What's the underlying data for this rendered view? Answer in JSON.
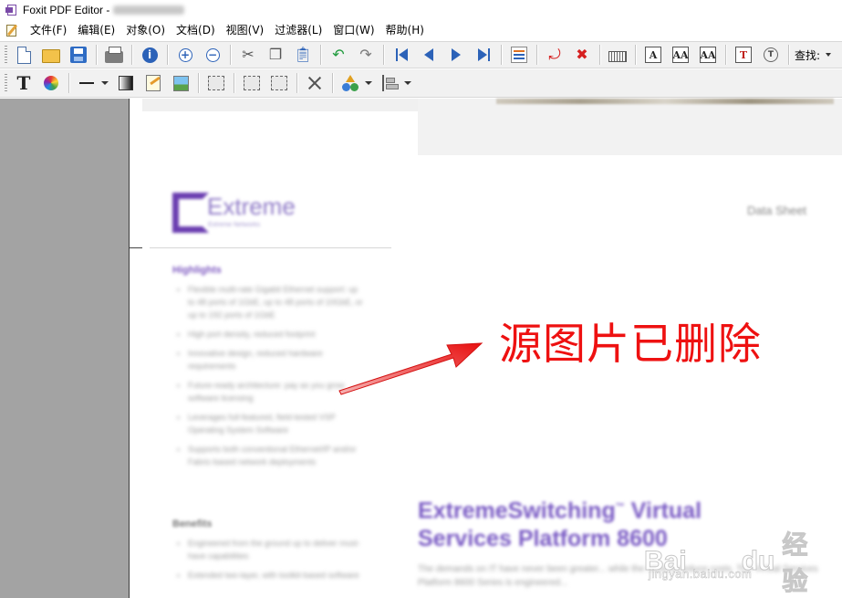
{
  "window": {
    "title": "Foxit PDF Editor -",
    "colors": {
      "toolbar_bg": "#f1f1f1",
      "left_pane": "#a3a3a3",
      "annotation_red": "#ee1111",
      "brand_purple": "#7a5bc4"
    }
  },
  "menu": {
    "items": [
      {
        "label": "文件(F)"
      },
      {
        "label": "编辑(E)"
      },
      {
        "label": "对象(O)"
      },
      {
        "label": "文档(D)"
      },
      {
        "label": "视图(V)"
      },
      {
        "label": "过滤器(L)"
      },
      {
        "label": "窗口(W)"
      },
      {
        "label": "帮助(H)"
      }
    ]
  },
  "toolbar": {
    "find_label": "查找:",
    "icons_row1": [
      "new-document-icon",
      "open-folder-icon",
      "save-disk-icon",
      "print-icon",
      "info-icon",
      "zoom-in-icon",
      "zoom-out-icon",
      "cut-icon",
      "copy-icon",
      "paste-icon",
      "undo-icon",
      "redo-icon",
      "first-page-icon",
      "previous-page-icon",
      "next-page-icon",
      "last-page-icon",
      "page-properties-icon",
      "rotate-page-icon",
      "delete-page-icon",
      "keyboard-icon",
      "text-tool-icon",
      "text-spacing-icon",
      "text-grid-icon",
      "text-frame-icon",
      "object-target-icon"
    ],
    "icons_row2": [
      "add-text-icon",
      "color-wheel-icon",
      "line-icon",
      "gradient-icon",
      "edit-content-icon",
      "insert-image-icon",
      "select-group-icon",
      "align-objects-icon",
      "distribute-objects-icon",
      "tools-icon",
      "shapes-icon",
      "alignment-icon"
    ]
  },
  "document": {
    "logo_text": "Extreme",
    "logo_tagline": "Extreme Networks",
    "header_right": "Data Sheet",
    "highlights_heading": "Highlights",
    "highlights": [
      "Flexible multi-rate Gigabit Ethernet support: up to 48 ports of 1GbE, up to 48 ports of 10GbE, or up to 192 ports of 1GbE",
      "High port density, reduced footprint",
      "Innovative design, reduced hardware requirements",
      "Future-ready architecture: pay as you grow software licensing",
      "Leverages full-featured, field-tested VSP Operating System Software",
      "Supports both conventional Ethernet/IP and/or Fabric-based network deployments"
    ],
    "benefits_heading": "Benefits",
    "benefits": [
      "Engineered from the ground up to deliver must-have capabilities",
      "Extended two-layer, with toolkit-based software"
    ],
    "product_title_line1": "ExtremeSwitching",
    "product_title_mark": "™",
    "product_title_line1_tail": " Virtual",
    "product_title_line2": "Services Platform 8600",
    "intro": "The demands on IT have never been greater... while the need to reduce costs. The Virtual Services Platform 8600 Series is engineered..."
  },
  "annotation": {
    "text": "源图片已删除"
  },
  "watermark": {
    "brand_bai": "Bai",
    "brand_du": "du",
    "brand_cn": "经验",
    "url": "jingyan.baidu.com"
  }
}
